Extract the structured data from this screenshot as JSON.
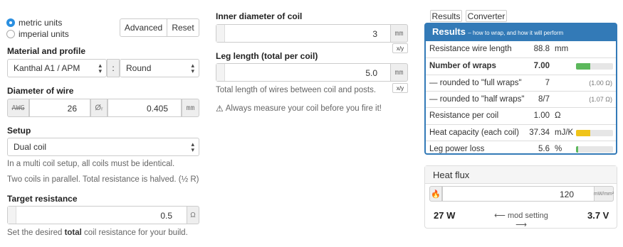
{
  "units": {
    "metric_label": "metric units",
    "imperial_label": "imperial units",
    "advanced_label": "Advanced",
    "reset_label": "Reset"
  },
  "material": {
    "label": "Material and profile",
    "material_value": "Kanthal A1 / APM",
    "separator": ":",
    "profile_value": "Round"
  },
  "diameter": {
    "label": "Diameter of wire",
    "awg_addon": "AWG",
    "awg_value": "26",
    "mm_prefix": "Øᵣ",
    "mm_value": "0.405",
    "mm_unit": "mm"
  },
  "setup": {
    "label": "Setup",
    "value": "Dual coil",
    "help1": "In a multi coil setup, all coils must be identical.",
    "help2": "Two coils in parallel. Total resistance is halved. (½ R)"
  },
  "target": {
    "label": "Target resistance",
    "value": "0.5",
    "unit": "Ω",
    "help_pre": "Set the desired ",
    "help_bold": "total",
    "help_post": " coil resistance for your build."
  },
  "inner": {
    "label": "Inner diameter of coil",
    "value": "3",
    "unit": "mm",
    "toggle": "x/y"
  },
  "leg": {
    "label": "Leg length (total per coil)",
    "value": "5.0",
    "unit": "mm",
    "toggle": "x/y",
    "help": "Total length of wires between coil and posts.",
    "warning": "Always measure your coil before you fire it!"
  },
  "tabs": [
    "Results",
    "Converter"
  ],
  "results": {
    "title": "Results",
    "subtitle": "– how to wrap, and how it will perform",
    "rows": [
      {
        "label": "Resistance wire length",
        "value": "88.8",
        "unit": "mm",
        "extra": ""
      },
      {
        "label": "Number of wraps",
        "value": "7.00",
        "unit": "",
        "extra": ""
      },
      {
        "label": "— rounded to \"full wraps\"",
        "value": "7",
        "unit": "",
        "extra": "(1.00 Ω)"
      },
      {
        "label": "— rounded to \"half wraps\"",
        "value": "8/7",
        "unit": "",
        "extra": "(1.07 Ω)"
      },
      {
        "label": "Resistance per coil",
        "value": "1.00",
        "unit": "Ω",
        "extra": ""
      },
      {
        "label": "Heat capacity (each coil)",
        "value": "37.34",
        "unit": "mJ/K",
        "extra": ""
      },
      {
        "label": "Leg power loss",
        "value": "5.6",
        "unit": "%",
        "extra": ""
      }
    ],
    "bars": {
      "wraps": 0.38,
      "heat_capacity": 0.38,
      "leg_loss": 0.06
    },
    "colors": {
      "header": "#337ab7",
      "green": "#5cb85c",
      "yellow": "#f0c419"
    }
  },
  "heatflux": {
    "title": "Heat flux",
    "value": "120",
    "unit": "mW/mm²",
    "icon": "flame-icon",
    "watts": "27 W",
    "mid": "⟵ mod setting ⟶",
    "volts": "3.7 V"
  }
}
